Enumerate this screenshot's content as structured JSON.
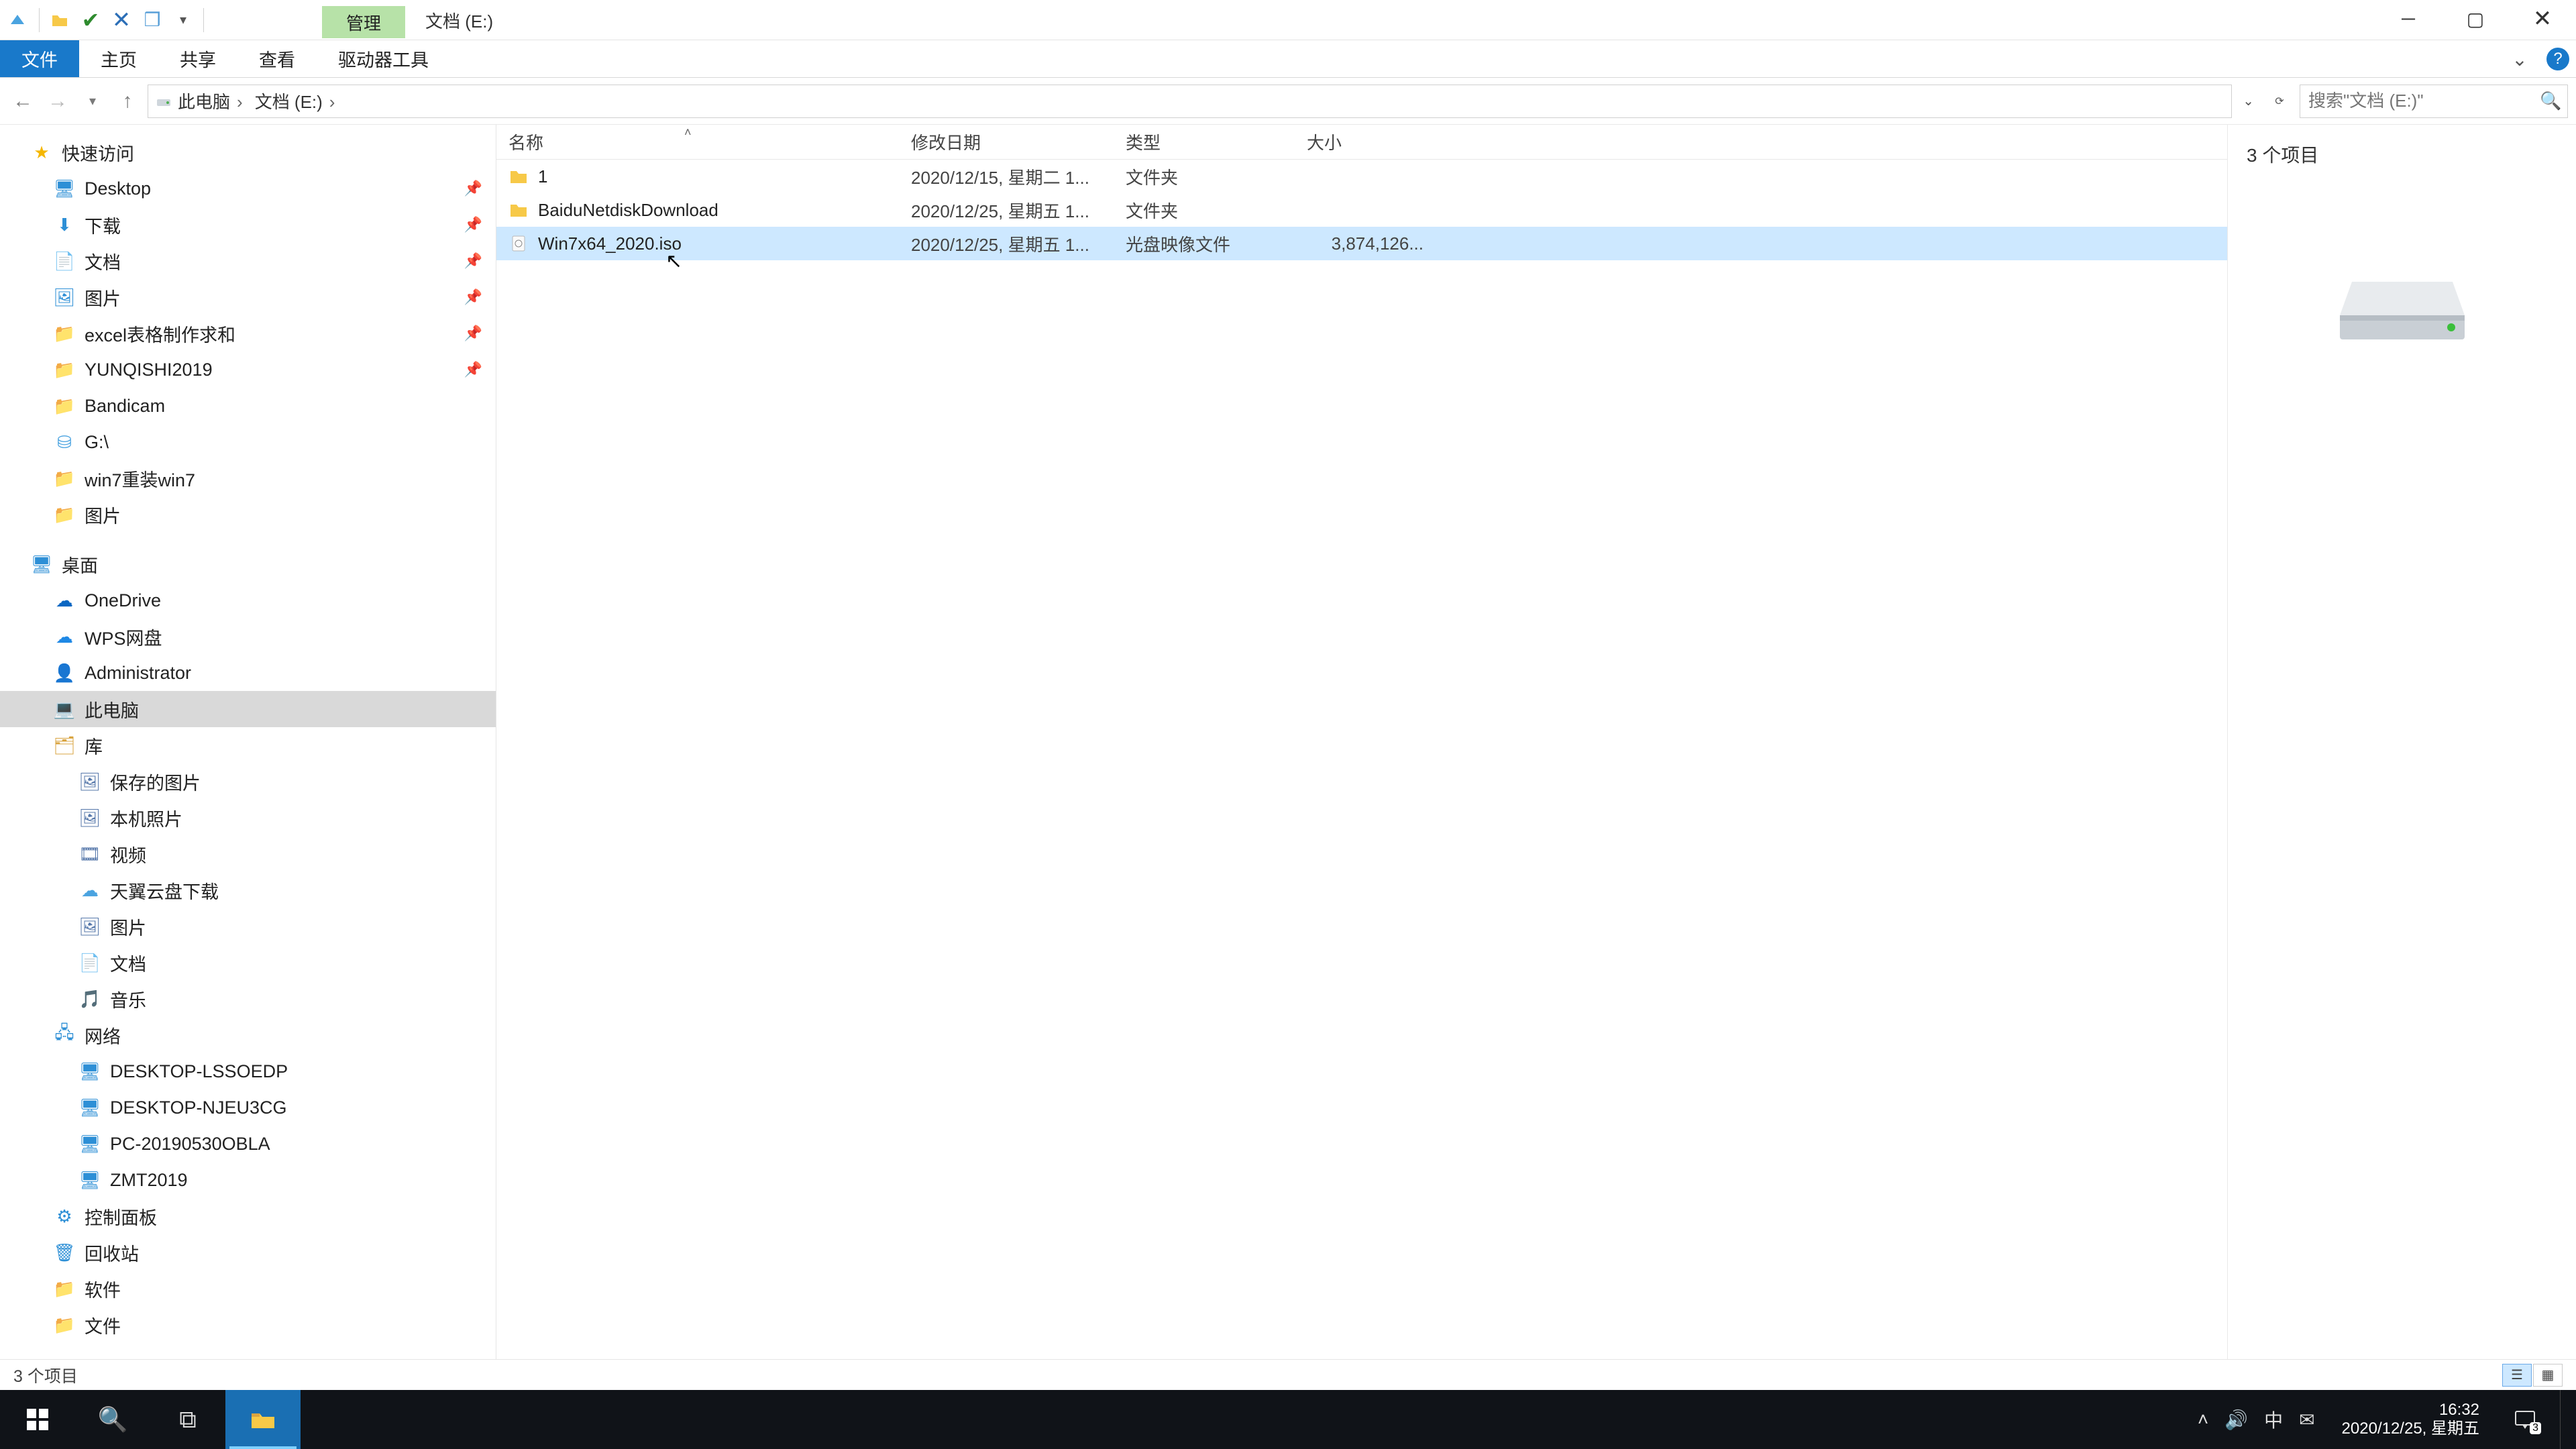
{
  "titlebar": {
    "context_tab": "管理",
    "location_label": "文档 (E:)"
  },
  "ribbon": {
    "file": "文件",
    "home": "主页",
    "share": "共享",
    "view": "查看",
    "drive_tools": "驱动器工具"
  },
  "breadcrumb": {
    "pc": "此电脑",
    "drive": "文档 (E:)"
  },
  "search": {
    "placeholder": "搜索\"文档 (E:)\""
  },
  "columns": {
    "name": "名称",
    "date": "修改日期",
    "type": "类型",
    "size": "大小"
  },
  "rows": [
    {
      "name": "1",
      "date": "2020/12/15, 星期二 1...",
      "type": "文件夹",
      "size": "",
      "kind": "folder",
      "selected": false
    },
    {
      "name": "BaiduNetdiskDownload",
      "date": "2020/12/25, 星期五 1...",
      "type": "文件夹",
      "size": "",
      "kind": "folder",
      "selected": false
    },
    {
      "name": "Win7x64_2020.iso",
      "date": "2020/12/25, 星期五 1...",
      "type": "光盘映像文件",
      "size": "3,874,126...",
      "kind": "iso",
      "selected": true
    }
  ],
  "tree": {
    "quick_access": "快速访问",
    "desktop": "Desktop",
    "downloads": "下载",
    "documents": "文档",
    "pictures": "图片",
    "excel_req": "excel表格制作求和",
    "yunqishi": "YUNQISHI2019",
    "bandicam": "Bandicam",
    "gdrive": "G:\\",
    "win7_reinstall": "win7重装win7",
    "pictures2": "图片",
    "desktop_root": "桌面",
    "onedrive": "OneDrive",
    "wps": "WPS网盘",
    "admin": "Administrator",
    "this_pc": "此电脑",
    "libraries": "库",
    "saved_pictures": "保存的图片",
    "camera_roll": "本机照片",
    "videos": "视频",
    "tianyi": "天翼云盘下载",
    "pictures3": "图片",
    "documents2": "文档",
    "music": "音乐",
    "network": "网络",
    "n1": "DESKTOP-LSSOEDP",
    "n2": "DESKTOP-NJEU3CG",
    "n3": "PC-20190530OBLA",
    "n4": "ZMT2019",
    "control_panel": "控制面板",
    "recycle": "回收站",
    "software": "软件",
    "files": "文件"
  },
  "preview": {
    "count_label": "3 个项目"
  },
  "status": {
    "items": "3 个项目"
  },
  "clock": {
    "time": "16:32",
    "date": "2020/12/25, 星期五"
  },
  "ime": "中",
  "notif_count": "3"
}
